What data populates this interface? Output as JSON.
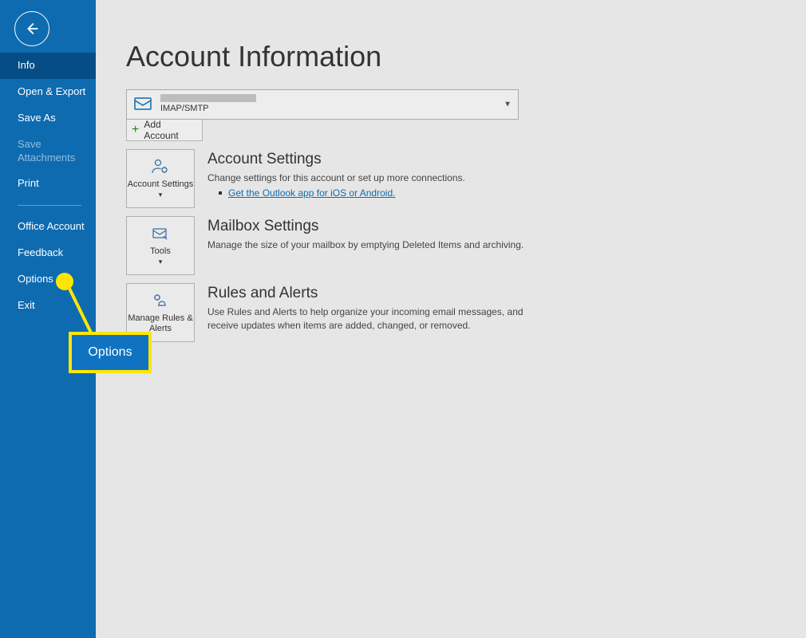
{
  "sidebar": {
    "items": [
      {
        "label": "Info",
        "active": true
      },
      {
        "label": "Open & Export"
      },
      {
        "label": "Save As"
      },
      {
        "label": "Save Attachments",
        "disabled": true
      },
      {
        "label": "Print"
      }
    ],
    "lower_items": [
      {
        "label": "Office Account"
      },
      {
        "label": "Feedback"
      },
      {
        "label": "Options"
      },
      {
        "label": "Exit"
      }
    ]
  },
  "page": {
    "title": "Account Information",
    "account_type": "IMAP/SMTP",
    "add_account": "Add Account"
  },
  "sections": {
    "account_settings": {
      "tile": "Account Settings",
      "title": "Account Settings",
      "desc": "Change settings for this account or set up more connections.",
      "link": "Get the Outlook app for iOS or Android."
    },
    "mailbox": {
      "tile": "Tools",
      "title": "Mailbox Settings",
      "desc": "Manage the size of your mailbox by emptying Deleted Items and archiving."
    },
    "rules": {
      "tile": "Manage Rules & Alerts",
      "title": "Rules and Alerts",
      "desc": "Use Rules and Alerts to help organize your incoming email messages, and receive updates when items are added, changed, or removed."
    }
  },
  "callout": {
    "label": "Options"
  }
}
